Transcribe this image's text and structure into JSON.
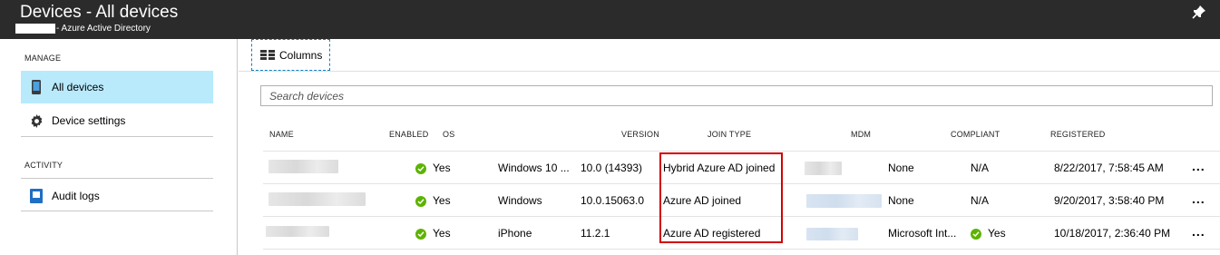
{
  "header": {
    "title": "Devices - All devices",
    "subtitle": "- Azure Active Directory"
  },
  "sidebar": {
    "manage_label": "MANAGE",
    "activity_label": "ACTIVITY",
    "items": [
      {
        "label": "All devices",
        "icon": "phone-icon"
      },
      {
        "label": "Device settings",
        "icon": "gear-icon"
      },
      {
        "label": "Audit logs",
        "icon": "log-icon"
      }
    ]
  },
  "toolbar": {
    "columns_label": "Columns"
  },
  "search": {
    "placeholder": "Search devices"
  },
  "table": {
    "headers": [
      "NAME",
      "ENABLED",
      "OS",
      "VERSION",
      "JOIN TYPE",
      "MDM",
      "COMPLIANT",
      "REGISTERED"
    ],
    "rows": [
      {
        "enabled": "Yes",
        "os": "Windows 10 ...",
        "version": "10.0 (14393)",
        "join_type": "Hybrid Azure AD joined",
        "mdm": "None",
        "compliant": "N/A",
        "registered": "8/22/2017, 7:58:45 AM",
        "more": "..."
      },
      {
        "enabled": "Yes",
        "os": "Windows",
        "version": "10.0.15063.0",
        "join_type": "Azure AD joined",
        "mdm": "None",
        "compliant": "N/A",
        "registered": "9/20/2017, 3:58:40 PM",
        "more": "..."
      },
      {
        "enabled": "Yes",
        "os": "iPhone",
        "version": "11.2.1",
        "join_type": "Azure AD registered",
        "mdm": "Microsoft Int...",
        "compliant": "Yes",
        "registered": "10/18/2017, 2:36:40 PM",
        "more": "..."
      }
    ]
  },
  "colors": {
    "titlebar": "#2b2b2b",
    "active_item": "#b8eafc",
    "check": "#5db300",
    "highlight": "#d10000",
    "accent": "#0f7fc5"
  }
}
